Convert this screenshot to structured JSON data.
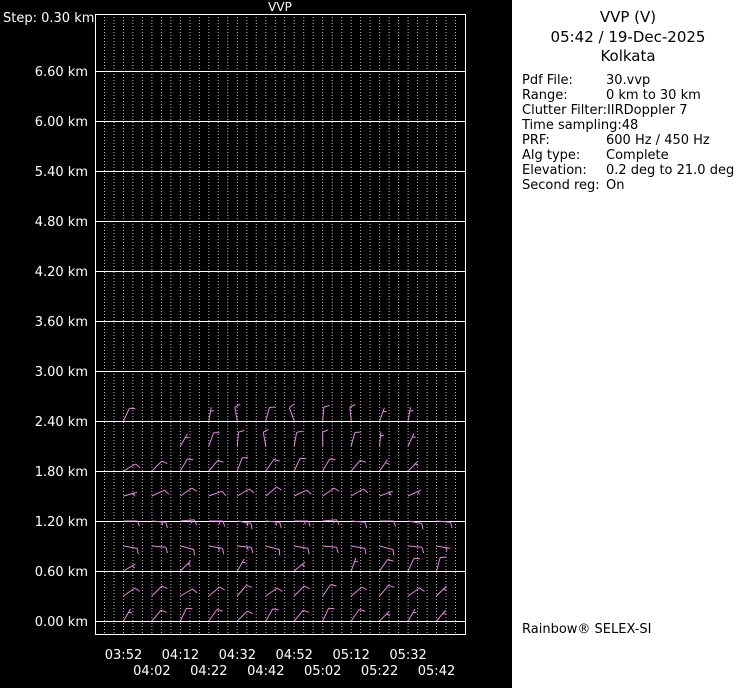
{
  "colors": {
    "background": "#000000",
    "panel_background": "#ffffff",
    "axis_text": "#ffffff",
    "grid_solid": "#ffffff",
    "grid_dotted": "#bbbbbb",
    "barb": "#ee82ee"
  },
  "right_panel": {
    "title": "VVP (V)",
    "datetime": "05:42 / 19-Dec-2025",
    "site": "Kolkata",
    "fields": [
      {
        "label": "Pdf File:",
        "value": "30.vvp"
      },
      {
        "label": "Range:",
        "value": "0 km to 30 km"
      },
      {
        "label": "Clutter Filter:",
        "value": "IIRDoppler 7"
      },
      {
        "label": "Time sampling:",
        "value": "48"
      },
      {
        "label": "PRF:",
        "value": "600 Hz / 450 Hz"
      },
      {
        "label": "Alg type:",
        "value": "Complete"
      },
      {
        "label": "Elevation:",
        "value": "0.2 deg to 21.0 deg"
      },
      {
        "label": "Second reg:",
        "value": "On"
      }
    ],
    "footer": "Rainbow® SELEX-SI"
  },
  "chart_data": {
    "type": "wind-barb-time-height",
    "title": "VVP",
    "step_label": "Step: 0.30 km",
    "height_step_km": 0.3,
    "y_tick_labels": [
      "6.60 km",
      "6.00 km",
      "5.40 km",
      "4.80 km",
      "4.20 km",
      "3.60 km",
      "3.00 km",
      "2.40 km",
      "1.80 km",
      "1.20 km",
      "0.60 km",
      "0.00 km"
    ],
    "x_times": [
      "03:52",
      "04:02",
      "04:12",
      "04:22",
      "04:32",
      "04:42",
      "04:52",
      "05:02",
      "05:12",
      "05:22",
      "05:32",
      "05:42"
    ],
    "x_label_row1": [
      "03:52",
      "04:12",
      "04:32",
      "04:52",
      "05:12",
      "05:32"
    ],
    "x_label_row2": [
      "04:02",
      "04:22",
      "04:42",
      "05:02",
      "05:22",
      "05:42"
    ],
    "grid": "solid horizontal per 0.60 km label, dotted vertical per sub-time-step",
    "legend_position": "none",
    "barb_unit": "kt",
    "barbs": [
      {
        "t": "03:52",
        "h": 2.4,
        "d": 25,
        "s": 10
      },
      {
        "t": "04:22",
        "h": 2.4,
        "d": 10,
        "s": 5
      },
      {
        "t": "04:32",
        "h": 2.4,
        "d": 350,
        "s": 10
      },
      {
        "t": "04:42",
        "h": 2.4,
        "d": 15,
        "s": 10
      },
      {
        "t": "04:52",
        "h": 2.4,
        "d": 340,
        "s": 10
      },
      {
        "t": "05:02",
        "h": 2.4,
        "d": 5,
        "s": 10
      },
      {
        "t": "05:12",
        "h": 2.4,
        "d": 355,
        "s": 10
      },
      {
        "t": "05:22",
        "h": 2.4,
        "d": 20,
        "s": 5
      },
      {
        "t": "05:32",
        "h": 2.4,
        "d": 10,
        "s": 5
      },
      {
        "t": "04:12",
        "h": 2.1,
        "d": 30,
        "s": 5
      },
      {
        "t": "04:22",
        "h": 2.1,
        "d": 20,
        "s": 10
      },
      {
        "t": "04:32",
        "h": 2.1,
        "d": 5,
        "s": 10
      },
      {
        "t": "04:42",
        "h": 2.1,
        "d": 350,
        "s": 10
      },
      {
        "t": "04:52",
        "h": 2.1,
        "d": 10,
        "s": 10
      },
      {
        "t": "05:02",
        "h": 2.1,
        "d": 0,
        "s": 10
      },
      {
        "t": "05:12",
        "h": 2.1,
        "d": 15,
        "s": 10
      },
      {
        "t": "05:22",
        "h": 2.1,
        "d": 5,
        "s": 5
      },
      {
        "t": "05:32",
        "h": 2.1,
        "d": 25,
        "s": 5
      },
      {
        "t": "03:52",
        "h": 1.8,
        "d": 60,
        "s": 10
      },
      {
        "t": "04:02",
        "h": 1.8,
        "d": 45,
        "s": 10
      },
      {
        "t": "04:12",
        "h": 1.8,
        "d": 30,
        "s": 10
      },
      {
        "t": "04:22",
        "h": 1.8,
        "d": 40,
        "s": 10
      },
      {
        "t": "04:32",
        "h": 1.8,
        "d": 20,
        "s": 10
      },
      {
        "t": "04:42",
        "h": 1.8,
        "d": 35,
        "s": 10
      },
      {
        "t": "04:52",
        "h": 1.8,
        "d": 25,
        "s": 10
      },
      {
        "t": "05:02",
        "h": 1.8,
        "d": 30,
        "s": 10
      },
      {
        "t": "05:12",
        "h": 1.8,
        "d": 40,
        "s": 10
      },
      {
        "t": "05:22",
        "h": 1.8,
        "d": 35,
        "s": 5
      },
      {
        "t": "05:32",
        "h": 1.8,
        "d": 45,
        "s": 5
      },
      {
        "t": "03:52",
        "h": 1.5,
        "d": 75,
        "s": 5
      },
      {
        "t": "04:02",
        "h": 1.5,
        "d": 65,
        "s": 10
      },
      {
        "t": "04:12",
        "h": 1.5,
        "d": 55,
        "s": 10
      },
      {
        "t": "04:22",
        "h": 1.5,
        "d": 70,
        "s": 10
      },
      {
        "t": "04:32",
        "h": 1.5,
        "d": 60,
        "s": 10
      },
      {
        "t": "04:42",
        "h": 1.5,
        "d": 50,
        "s": 10
      },
      {
        "t": "04:52",
        "h": 1.5,
        "d": 65,
        "s": 10
      },
      {
        "t": "05:02",
        "h": 1.5,
        "d": 55,
        "s": 10
      },
      {
        "t": "05:12",
        "h": 1.5,
        "d": 60,
        "s": 10
      },
      {
        "t": "05:22",
        "h": 1.5,
        "d": 70,
        "s": 5
      },
      {
        "t": "05:32",
        "h": 1.5,
        "d": 65,
        "s": 5
      },
      {
        "t": "03:52",
        "h": 1.2,
        "d": 90,
        "s": 10
      },
      {
        "t": "04:02",
        "h": 1.2,
        "d": 95,
        "s": 15
      },
      {
        "t": "04:12",
        "h": 1.2,
        "d": 85,
        "s": 15
      },
      {
        "t": "04:22",
        "h": 1.2,
        "d": 90,
        "s": 15
      },
      {
        "t": "04:32",
        "h": 1.2,
        "d": 100,
        "s": 15
      },
      {
        "t": "04:42",
        "h": 1.2,
        "d": 95,
        "s": 15
      },
      {
        "t": "04:52",
        "h": 1.2,
        "d": 90,
        "s": 15
      },
      {
        "t": "05:02",
        "h": 1.2,
        "d": 85,
        "s": 15
      },
      {
        "t": "05:12",
        "h": 1.2,
        "d": 95,
        "s": 10
      },
      {
        "t": "05:22",
        "h": 1.2,
        "d": 90,
        "s": 10
      },
      {
        "t": "05:32",
        "h": 1.2,
        "d": 100,
        "s": 10
      },
      {
        "t": "05:42",
        "h": 1.2,
        "d": 95,
        "s": 10
      },
      {
        "t": "03:52",
        "h": 0.9,
        "d": 100,
        "s": 10
      },
      {
        "t": "04:02",
        "h": 0.9,
        "d": 95,
        "s": 10
      },
      {
        "t": "04:12",
        "h": 0.9,
        "d": 105,
        "s": 10
      },
      {
        "t": "04:22",
        "h": 0.9,
        "d": 100,
        "s": 15
      },
      {
        "t": "04:32",
        "h": 0.9,
        "d": 95,
        "s": 15
      },
      {
        "t": "04:42",
        "h": 0.9,
        "d": 105,
        "s": 10
      },
      {
        "t": "04:52",
        "h": 0.9,
        "d": 100,
        "s": 10
      },
      {
        "t": "05:02",
        "h": 0.9,
        "d": 95,
        "s": 10
      },
      {
        "t": "05:12",
        "h": 0.9,
        "d": 100,
        "s": 10
      },
      {
        "t": "05:22",
        "h": 0.9,
        "d": 105,
        "s": 10
      },
      {
        "t": "05:32",
        "h": 0.9,
        "d": 95,
        "s": 10
      },
      {
        "t": "05:42",
        "h": 0.9,
        "d": 100,
        "s": 5
      },
      {
        "t": "03:52",
        "h": 0.6,
        "d": 60,
        "s": 5
      },
      {
        "t": "04:12",
        "h": 0.6,
        "d": 45,
        "s": 5
      },
      {
        "t": "04:32",
        "h": 0.6,
        "d": 30,
        "s": 5
      },
      {
        "t": "04:52",
        "h": 0.6,
        "d": 50,
        "s": 5
      },
      {
        "t": "05:12",
        "h": 0.6,
        "d": 20,
        "s": 5
      },
      {
        "t": "05:22",
        "h": 0.6,
        "d": 35,
        "s": 10
      },
      {
        "t": "05:32",
        "h": 0.6,
        "d": 25,
        "s": 10
      },
      {
        "t": "05:42",
        "h": 0.6,
        "d": 15,
        "s": 10
      },
      {
        "t": "03:52",
        "h": 0.3,
        "d": 55,
        "s": 10
      },
      {
        "t": "04:02",
        "h": 0.3,
        "d": 45,
        "s": 10
      },
      {
        "t": "04:12",
        "h": 0.3,
        "d": 60,
        "s": 10
      },
      {
        "t": "04:22",
        "h": 0.3,
        "d": 50,
        "s": 10
      },
      {
        "t": "04:32",
        "h": 0.3,
        "d": 40,
        "s": 10
      },
      {
        "t": "04:42",
        "h": 0.3,
        "d": 55,
        "s": 10
      },
      {
        "t": "04:52",
        "h": 0.3,
        "d": 45,
        "s": 10
      },
      {
        "t": "05:02",
        "h": 0.3,
        "d": 35,
        "s": 10
      },
      {
        "t": "05:12",
        "h": 0.3,
        "d": 50,
        "s": 10
      },
      {
        "t": "05:22",
        "h": 0.3,
        "d": 40,
        "s": 10
      },
      {
        "t": "05:32",
        "h": 0.3,
        "d": 55,
        "s": 10
      },
      {
        "t": "05:42",
        "h": 0.3,
        "d": 45,
        "s": 5
      },
      {
        "t": "03:52",
        "h": 0.0,
        "d": 30,
        "s": 5
      },
      {
        "t": "04:02",
        "h": 0.0,
        "d": 40,
        "s": 10
      },
      {
        "t": "04:12",
        "h": 0.0,
        "d": 25,
        "s": 10
      },
      {
        "t": "04:22",
        "h": 0.0,
        "d": 35,
        "s": 10
      },
      {
        "t": "04:32",
        "h": 0.0,
        "d": 45,
        "s": 10
      },
      {
        "t": "04:42",
        "h": 0.0,
        "d": 30,
        "s": 10
      },
      {
        "t": "04:52",
        "h": 0.0,
        "d": 40,
        "s": 10
      },
      {
        "t": "05:02",
        "h": 0.0,
        "d": 25,
        "s": 10
      },
      {
        "t": "05:12",
        "h": 0.0,
        "d": 35,
        "s": 10
      },
      {
        "t": "05:22",
        "h": 0.0,
        "d": 45,
        "s": 5
      },
      {
        "t": "05:32",
        "h": 0.0,
        "d": 30,
        "s": 5
      },
      {
        "t": "05:42",
        "h": 0.0,
        "d": 40,
        "s": 5
      }
    ]
  }
}
